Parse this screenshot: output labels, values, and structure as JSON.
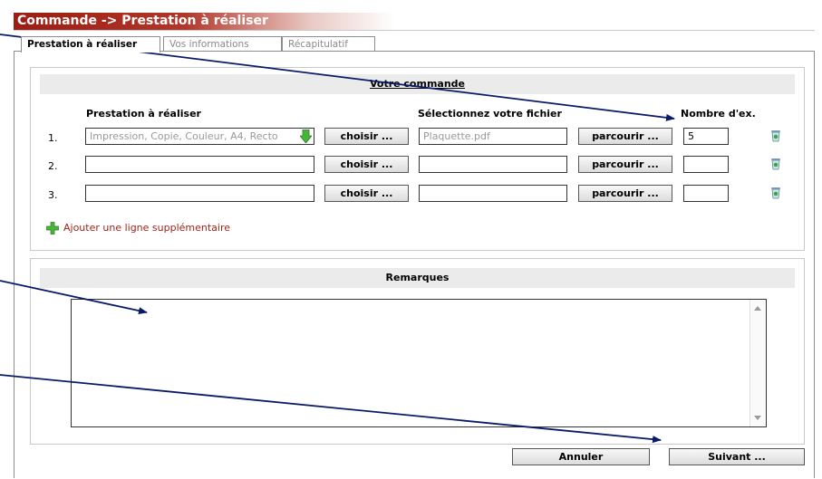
{
  "title": "Commande -> Prestation à réaliser",
  "tabs": [
    {
      "label": "Prestation à réaliser",
      "active": true
    },
    {
      "label": "Vos informations",
      "active": false
    },
    {
      "label": "Récapitulatif",
      "active": false
    }
  ],
  "order": {
    "section_title": "Votre commande",
    "col_prestation": "Prestation à réaliser",
    "col_file": "Sélectionnez votre fichier",
    "col_count": "Nombre d'ex.",
    "choose_label": "choisir ...",
    "browse_label": "parcourir ...",
    "rows": [
      {
        "num": "1.",
        "prestation": "Impression, Copie, Couleur, A4, Recto",
        "file": "Plaquette.pdf",
        "count": "5"
      },
      {
        "num": "2.",
        "prestation": "",
        "file": "",
        "count": ""
      },
      {
        "num": "3.",
        "prestation": "",
        "file": "",
        "count": ""
      }
    ],
    "add_line": "Ajouter une ligne supplémentaire"
  },
  "remarks": {
    "section_title": "Remarques",
    "value": ""
  },
  "actions": {
    "cancel": "Annuler",
    "next": "Suivant ..."
  },
  "colors": {
    "brand": "#9b1d13",
    "link": "#a3231a",
    "arrow": "#0a1a6b"
  },
  "icons": [
    "trash-icon",
    "add-icon",
    "dropdown-arrow-icon"
  ]
}
